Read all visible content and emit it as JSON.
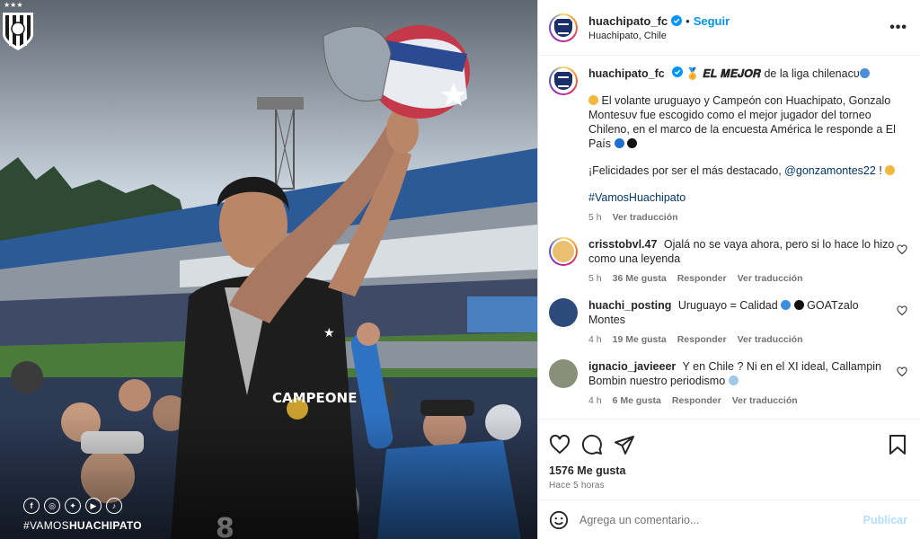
{
  "post": {
    "username": "huachipato_fc",
    "follow_label": "Seguir",
    "location": "Huachipato, Chile",
    "more_label": "•••"
  },
  "photo": {
    "social_icons": [
      "facebook-icon",
      "instagram-icon",
      "twitter-icon",
      "youtube-icon",
      "tiktok-icon"
    ],
    "hashtag_prefix": "#VAMOS",
    "hashtag_bold": "HUACHIPATO",
    "shirt_text": "CAMPEONE"
  },
  "caption": {
    "username": "huachipato_fc",
    "line1_pre": "🏅",
    "line1_bold": "𝑬𝑳 𝑴𝑬𝑱𝑶𝑹",
    "line1_post": "de la liga chilenacᴜ",
    "para1": "El volante uruguayo y Campeón con Huachipato, Gonzalo Montesᴜᴠ fue escogido como el mejor jugador del torneo Chileno, en el marco de la encuesta América le responde a El País",
    "para2_pre": "¡Felicidades por ser el más destacado,",
    "para2_mention": "@gonzamontes22",
    "para2_post": "!",
    "hashtag": "#VamosHuachipato",
    "time": "5 h",
    "translate": "Ver traducción"
  },
  "comments": [
    {
      "username": "crisstobvl.47",
      "text": "Ojalá no se vaya ahora, pero si lo hace lo hizo como una leyenda",
      "time": "5 h",
      "likes": "36 Me gusta",
      "reply": "Responder",
      "translate": "Ver traducción"
    },
    {
      "username": "huachi_posting",
      "text_pre": "Uruguayo = Calidad",
      "text_post": "GOATzalo Montes",
      "time": "4 h",
      "likes": "19 Me gusta",
      "reply": "Responder",
      "translate": "Ver traducción"
    },
    {
      "username": "ignacio_javieeer",
      "text": "Y en Chile ? Ni en el XI ideal, Callampin Bombin nuestro periodismo",
      "time": "4 h",
      "likes": "6 Me gusta",
      "reply": "Responder",
      "translate": "Ver traducción"
    }
  ],
  "footer": {
    "likes": "1576 Me gusta",
    "time_ago": "Hace 5 horas",
    "comment_placeholder": "Agrega un comentario...",
    "publish_label": "Publicar"
  },
  "colors": {
    "link_blue": "#0095f6",
    "mention": "#00376b",
    "club_navy": "#1b2f6b"
  }
}
